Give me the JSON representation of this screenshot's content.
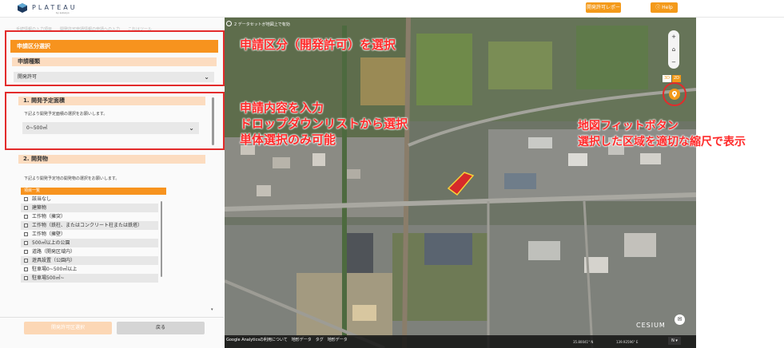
{
  "header": {
    "logo_text": "PLATEAU",
    "logo_sub": "by eukaryo",
    "report_button": "開発許可レポート一覧",
    "help_button": "Help"
  },
  "left_panel": {
    "breadcrumb": "手続情報の入力項目　　開発許可申請情報の申請への入力　　これはツール",
    "section_title": "申請区分選択",
    "application_type_label": "申請種類",
    "application_type_value": "開発許可",
    "q1": {
      "title": "1. 開発予定面積",
      "description": "下記より開発予定面積の選択をお願いします。",
      "selected": "0~500㎡"
    },
    "q2": {
      "title": "2. 開発物",
      "description": "下記より開発予定地の開発物の選択をお願いします。",
      "list_header": "項目一覧",
      "items": [
        "該当なし",
        "建築物",
        "工作物（擁突）",
        "工作物（鉄柱、またはコンクリート柱または鉄塔）",
        "工作物（擁壁）",
        "500㎡以上の公園",
        "道路（開発区域内）",
        "遊具設置（公園内）",
        "駐車場0~500㎡以上",
        "駐車場500㎡~"
      ]
    },
    "next_button": "開発許可区選択",
    "back_button": "戻る"
  },
  "map": {
    "dataset_notice": "2 データセットが地図上で有効",
    "zoom_in": "+",
    "home": "⌂",
    "zoom_out": "−",
    "mode_3d": "3D",
    "mode_2d": "2D",
    "links": "Google Analyticsの利用について　地形データ　タグ　地形データ",
    "cesium": "CESIUM",
    "lat": "35.80041° N",
    "lon": "139.92596° E",
    "compass": "N ▾",
    "chat": "✉"
  },
  "annotations": {
    "a1": "申請区分（開発許可）を選択",
    "a2_line1": "申請内容を入力",
    "a2_line2": "ドロップダウンリストから選択",
    "a2_line3": "単体選択のみ可能",
    "a3_line1": "地図フィットボタン",
    "a3_line2": "選択した区域を適切な縮尺で表示"
  },
  "colors": {
    "accent": "#f7931e",
    "annotation_red": "#e32b2b",
    "highlight_parcel": "#d62a2a"
  }
}
